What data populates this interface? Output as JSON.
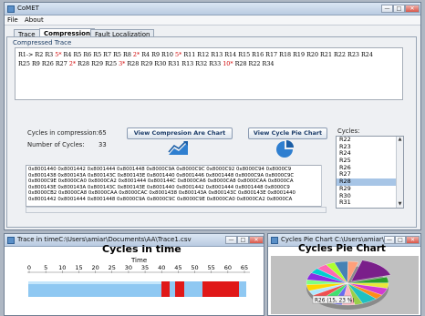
{
  "main_window": {
    "title": "CoMET",
    "menus": [
      "File",
      "About"
    ],
    "tabs": [
      "Trace",
      "Compression",
      "Fault Localization"
    ],
    "active_tab": "Compression",
    "compressed_trace_label": "Compressed Trace",
    "trace_segments": [
      {
        "t": "R1-> R2 R3 ",
        "r": false
      },
      {
        "t": "5*",
        "r": true
      },
      {
        "t": " R4 R5 R6 R5 R7 R5 R8 ",
        "r": false
      },
      {
        "t": "2*",
        "r": true
      },
      {
        "t": " R4 R9 R10 ",
        "r": false
      },
      {
        "t": "5*",
        "r": true
      },
      {
        "t": " R11 R12 R13 R14 R15 R16 R17 R18 R19 R20 R21 R22 R23 R24\nR25 R9 R26 R27 ",
        "r": false
      },
      {
        "t": "2*",
        "r": true
      },
      {
        "t": " R28 R29 R25 ",
        "r": false
      },
      {
        "t": "3*",
        "r": true
      },
      {
        "t": " R28 R29 R30 R31 R13 R32 R33 ",
        "r": false
      },
      {
        "t": "10*",
        "r": true
      },
      {
        "t": " R28 R22 R34",
        "r": false
      }
    ],
    "cycles_in_compression_label": "Cycles in compression:",
    "cycles_in_compression_value": "65",
    "number_of_cycles_label": "Number of Cycles:",
    "number_of_cycles_value": "33",
    "view_chart_button": "View Compresion Are Chart",
    "view_pie_button": "View Cycle Pie Chart",
    "cycles_label": "Cycles:",
    "cycles_list": [
      "R22",
      "R23",
      "R24",
      "R25",
      "R26",
      "R27",
      "R28",
      "R29",
      "R30",
      "R31"
    ],
    "selected_cycle": "R28",
    "hex_lines": [
      "0x8001440 0x8001442 0x8001444 0x8001448 0x8000C9A 0x8000C9C 0x8000C92 0x8000C94 0x8000C9",
      "0x8001438 0x800143A 0x800143C 0x800143E 0x8001440 0x8001446 0x8001448 0x8000C9A 0x8000C9C",
      "0x8000C9E 0x8000CA0 0x8000CA2 0x8001444 0x800144C 0x8000CA6 0x8000CA8 0x8000CAA 0x8000CA",
      "0x800143E 0x800143A 0x800143C 0x800143E 0x8001440 0x8001442 0x8001444 0x8001448 0x8000C9",
      "0x8000CB2 0x8000CA8 0x8000CAA 0x8000CAC 0x8001438 0x800143A 0x800143C 0x800143E 0x8001440",
      "0x8001442 0x8001444 0x8001448 0x8000C9A 0x8000C9C 0x8000C9E 0x8000CA0 0x8000CA2 0x8000CA"
    ]
  },
  "trace_window": {
    "title": "Trace in timeC:\\Users\\amiar\\Documents\\AA\\Trace1.csv",
    "chart_title": "Cycles in time",
    "axis_title": "Time",
    "ticks": [
      "0",
      "5",
      "10",
      "15",
      "20",
      "25",
      "30",
      "35",
      "40",
      "45",
      "50",
      "55",
      "60",
      "65"
    ]
  },
  "pie_window": {
    "title": "Cycles Pie Chart  C:\\Users\\amiar\\...",
    "chart_title": "Cycles Pie Chart",
    "tooltip": "R26 (15, 23 %)"
  },
  "colors": {
    "accent": "#2f7fd0",
    "bar_blue": "#8fc8f2",
    "bar_red": "#e01818",
    "pie_bg": "#c0c0c0"
  }
}
